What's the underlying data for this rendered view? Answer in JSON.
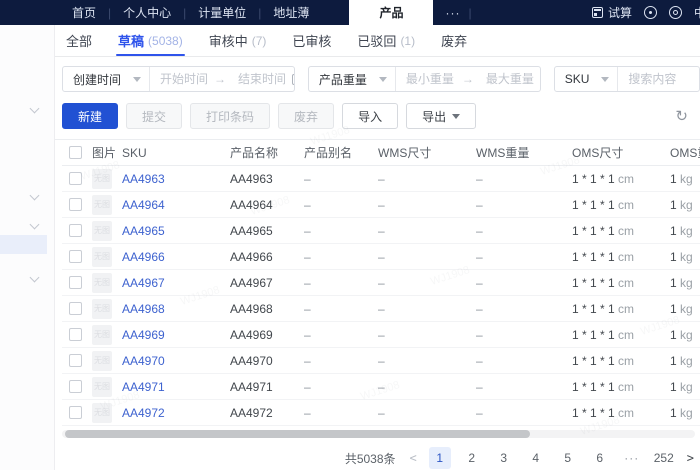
{
  "navbar": {
    "items": [
      "首页",
      "个人中心",
      "计量单位",
      "地址薄"
    ],
    "active_tab": "产品",
    "more": "···",
    "trial_label": "试算",
    "language": "中"
  },
  "tabs": [
    {
      "label": "全部",
      "count": "",
      "active": false
    },
    {
      "label": "草稿",
      "count": "(5038)",
      "active": true
    },
    {
      "label": "审核中",
      "count": "(7)",
      "active": false
    },
    {
      "label": "已审核",
      "count": "",
      "active": false
    },
    {
      "label": "已驳回",
      "count": "(1)",
      "active": false
    },
    {
      "label": "废弃",
      "count": "",
      "active": false
    }
  ],
  "filters": {
    "time_field": "创建时间",
    "start_placeholder": "开始时间",
    "end_placeholder": "结束时间",
    "arrow": "→",
    "weight_field": "产品重量",
    "min_placeholder": "最小重量",
    "max_placeholder": "最大重量",
    "search_field": "SKU",
    "search_placeholder": "搜索内容"
  },
  "toolbar": {
    "new_label": "新建",
    "submit_label": "提交",
    "print_label": "打印条码",
    "discard_label": "废弃",
    "import_label": "导入",
    "export_label": "导出"
  },
  "table": {
    "headers": [
      "图片",
      "SKU",
      "产品名称",
      "产品别名",
      "WMS尺寸",
      "WMS重量",
      "OMS尺寸",
      "OMS重量"
    ],
    "img_placeholder": "无图",
    "rows": [
      {
        "sku": "AA4963",
        "name": "AA4963",
        "alias": "–",
        "wms_size": "–",
        "wms_weight": "–",
        "oms_size": "1 * 1 * 1",
        "oms_size_unit": "cm",
        "oms_weight": "1",
        "oms_weight_unit": "kg"
      },
      {
        "sku": "AA4964",
        "name": "AA4964",
        "alias": "–",
        "wms_size": "–",
        "wms_weight": "–",
        "oms_size": "1 * 1 * 1",
        "oms_size_unit": "cm",
        "oms_weight": "1",
        "oms_weight_unit": "kg"
      },
      {
        "sku": "AA4965",
        "name": "AA4965",
        "alias": "–",
        "wms_size": "–",
        "wms_weight": "–",
        "oms_size": "1 * 1 * 1",
        "oms_size_unit": "cm",
        "oms_weight": "1",
        "oms_weight_unit": "kg"
      },
      {
        "sku": "AA4966",
        "name": "AA4966",
        "alias": "–",
        "wms_size": "–",
        "wms_weight": "–",
        "oms_size": "1 * 1 * 1",
        "oms_size_unit": "cm",
        "oms_weight": "1",
        "oms_weight_unit": "kg"
      },
      {
        "sku": "AA4967",
        "name": "AA4967",
        "alias": "–",
        "wms_size": "–",
        "wms_weight": "–",
        "oms_size": "1 * 1 * 1",
        "oms_size_unit": "cm",
        "oms_weight": "1",
        "oms_weight_unit": "kg"
      },
      {
        "sku": "AA4968",
        "name": "AA4968",
        "alias": "–",
        "wms_size": "–",
        "wms_weight": "–",
        "oms_size": "1 * 1 * 1",
        "oms_size_unit": "cm",
        "oms_weight": "1",
        "oms_weight_unit": "kg"
      },
      {
        "sku": "AA4969",
        "name": "AA4969",
        "alias": "–",
        "wms_size": "–",
        "wms_weight": "–",
        "oms_size": "1 * 1 * 1",
        "oms_size_unit": "cm",
        "oms_weight": "1",
        "oms_weight_unit": "kg"
      },
      {
        "sku": "AA4970",
        "name": "AA4970",
        "alias": "–",
        "wms_size": "–",
        "wms_weight": "–",
        "oms_size": "1 * 1 * 1",
        "oms_size_unit": "cm",
        "oms_weight": "1",
        "oms_weight_unit": "kg"
      },
      {
        "sku": "AA4971",
        "name": "AA4971",
        "alias": "–",
        "wms_size": "–",
        "wms_weight": "–",
        "oms_size": "1 * 1 * 1",
        "oms_size_unit": "cm",
        "oms_weight": "1",
        "oms_weight_unit": "kg"
      },
      {
        "sku": "AA4972",
        "name": "AA4972",
        "alias": "–",
        "wms_size": "–",
        "wms_weight": "–",
        "oms_size": "1 * 1 * 1",
        "oms_size_unit": "cm",
        "oms_weight": "1",
        "oms_weight_unit": "kg"
      }
    ]
  },
  "pagination": {
    "total": "共5038条",
    "prev": "<",
    "next": ">",
    "pages": [
      "1",
      "2",
      "3",
      "4",
      "5",
      "6",
      "···",
      "252"
    ],
    "active_page": "1"
  },
  "watermark": "WJ1908",
  "colors": {
    "navbar_bg": "#0d1b3e",
    "accent": "#2f54eb",
    "primary_button": "#2151d3",
    "link": "#3d62cf",
    "active_page_bg": "#e7eefc"
  }
}
